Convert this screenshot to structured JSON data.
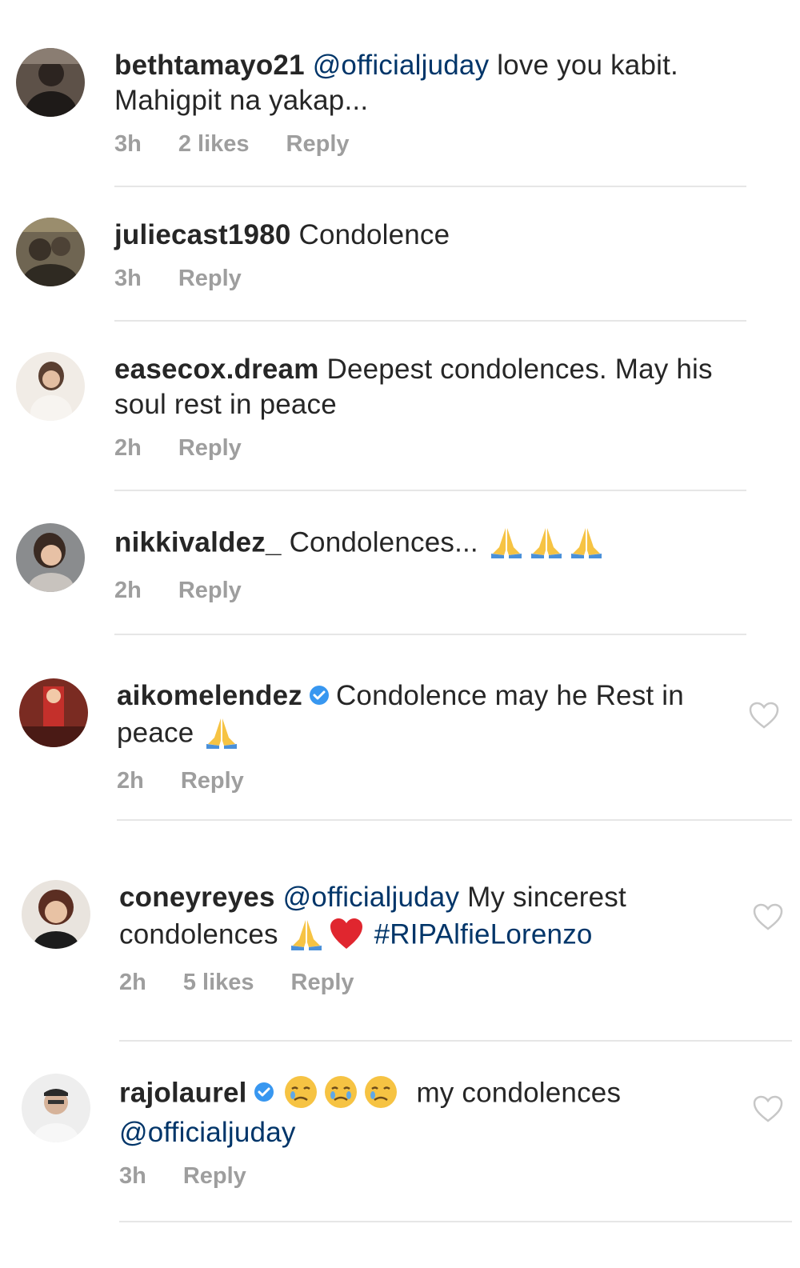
{
  "comments": [
    {
      "username": "bethtamayo21",
      "mention": "@officialjuday",
      "text": " love you kabit. Mahigpit na yakap...",
      "time": "3h",
      "likes": "2 likes",
      "reply": "Reply"
    },
    {
      "username": "juliecast1980",
      "text": "Condolence",
      "time": "3h",
      "reply": "Reply"
    },
    {
      "username": "easecox.dream",
      "text": "Deepest condolences. May his soul rest in peace",
      "time": "2h",
      "reply": "Reply"
    },
    {
      "username": "nikkivaldez_",
      "text": "Condolences...",
      "emojis": [
        "folded-hands",
        "folded-hands",
        "folded-hands"
      ],
      "time": "2h",
      "reply": "Reply"
    },
    {
      "username": "aikomelendez",
      "verified": true,
      "text": "Condolence may he Rest in peace",
      "emojis": [
        "folded-hands"
      ],
      "time": "2h",
      "reply": "Reply"
    },
    {
      "username": "coneyreyes",
      "mention": "@officialjuday",
      "text": " My sincerest condolences",
      "emojis": [
        "folded-hands",
        "red-heart"
      ],
      "hashtag": "#RIPAlfieLorenzo",
      "time": "2h",
      "likes": "5 likes",
      "reply": "Reply"
    },
    {
      "username": "rajolaurel",
      "verified": true,
      "emojis": [
        "crying-face",
        "crying-face",
        "crying-face"
      ],
      "text": "my condolences",
      "mention": "@officialjuday",
      "time": "3h",
      "reply": "Reply"
    }
  ],
  "colors": {
    "text": "#262626",
    "meta": "#9e9e9e",
    "link": "#003569",
    "verified": "#3897f0",
    "divider": "#e6e6e6",
    "heart": "#c7c7c7"
  },
  "icons": [
    "avatar",
    "verified-badge-icon",
    "folded-hands-emoji",
    "red-heart-emoji",
    "crying-face-emoji",
    "heart-icon"
  ]
}
